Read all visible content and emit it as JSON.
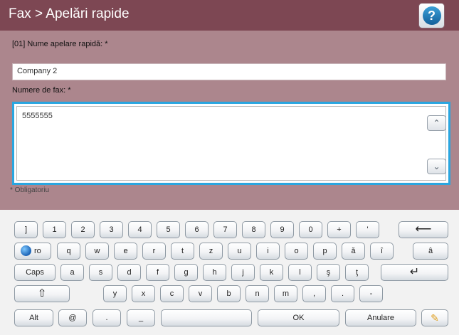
{
  "header": {
    "title": "Fax > Apelări rapide",
    "help_label": "?"
  },
  "form": {
    "name_label": "[01] Nume apelare rapidă: *",
    "name_value": "Company 2",
    "fax_label": "Numere de fax: *",
    "fax_value": "5555555",
    "scroll_up": "⌃",
    "scroll_down": "⌄",
    "required_note": "* Obligatoriu"
  },
  "keyboard": {
    "row1": [
      "]",
      "1",
      "2",
      "3",
      "4",
      "5",
      "6",
      "7",
      "8",
      "9",
      "0",
      "+",
      "'",
      "⟵"
    ],
    "row2": [
      "ro",
      "q",
      "w",
      "e",
      "r",
      "t",
      "z",
      "u",
      "i",
      "o",
      "p",
      "ă",
      "î",
      "â"
    ],
    "row3": [
      "Caps",
      "a",
      "s",
      "d",
      "f",
      "g",
      "h",
      "j",
      "k",
      "l",
      "ş",
      "ţ",
      "↵"
    ],
    "row4": [
      "⇧",
      "y",
      "x",
      "c",
      "v",
      "b",
      "n",
      "m",
      ",",
      ".",
      "-"
    ],
    "row5": [
      "Alt",
      "@",
      ".",
      "_",
      "",
      "OK",
      "Anulare",
      "✎"
    ]
  },
  "colors": {
    "title_bar": "#7d4753",
    "panel": "#ac868d",
    "focus_border": "#2aa6e0",
    "keyboard_bg": "#f2f2f2"
  }
}
